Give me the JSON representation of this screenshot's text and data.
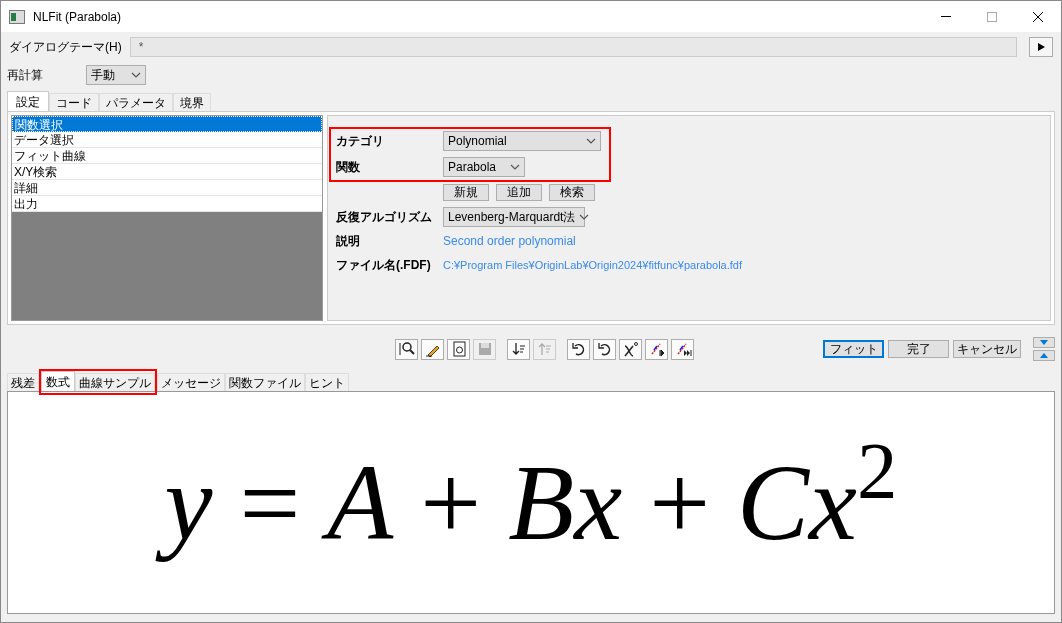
{
  "window": {
    "title": "NLFit (Parabola)"
  },
  "theme": {
    "label": "ダイアログテーマ(H)",
    "value": "*"
  },
  "recalc": {
    "label": "再計算",
    "value": "手動"
  },
  "tabs": [
    {
      "label": "設定",
      "selected": true
    },
    {
      "label": "コード",
      "selected": false
    },
    {
      "label": "パラメータ",
      "selected": false
    },
    {
      "label": "境界",
      "selected": false
    }
  ],
  "nav_list": [
    {
      "label": "関数選択",
      "selected": true
    },
    {
      "label": "データ選択",
      "selected": false
    },
    {
      "label": "フィット曲線",
      "selected": false
    },
    {
      "label": "X/Y検索",
      "selected": false
    },
    {
      "label": "詳細",
      "selected": false
    },
    {
      "label": "出力",
      "selected": false
    }
  ],
  "settings": {
    "category": {
      "label": "カテゴリ",
      "value": "Polynomial"
    },
    "function": {
      "label": "関数",
      "value": "Parabola"
    },
    "function_buttons": [
      "新規",
      "追加",
      "検索"
    ],
    "algorithm": {
      "label": "反復アルゴリズム",
      "value": "Levenberg-Marquardt法"
    },
    "description": {
      "label": "説明",
      "value": "Second order polynomial"
    },
    "file": {
      "label": "ファイル名(.FDF)",
      "value": "C:¥Program Files¥OriginLab¥Origin2024¥fitfunc¥parabola.fdf"
    }
  },
  "toolbar": [
    {
      "kind": "search",
      "disabled": false
    },
    {
      "kind": "edit",
      "disabled": false
    },
    {
      "kind": "doc",
      "disabled": false
    },
    {
      "kind": "save",
      "disabled": true
    },
    {
      "kind": "sortdown",
      "disabled": false
    },
    {
      "kind": "sortup",
      "disabled": true
    },
    {
      "kind": "undo",
      "disabled": false
    },
    {
      "kind": "undo",
      "disabled": false
    },
    {
      "kind": "chi",
      "disabled": false
    },
    {
      "kind": "step",
      "disabled": false
    },
    {
      "kind": "stepend",
      "disabled": false
    }
  ],
  "actions": [
    {
      "label": "フィット",
      "default": true
    },
    {
      "label": "完了",
      "default": false
    },
    {
      "label": "キャンセル",
      "default": false
    }
  ],
  "bottom_tabs": [
    {
      "label": "残差",
      "selected": false
    },
    {
      "label": "数式",
      "selected": true
    },
    {
      "label": "曲線サンプル",
      "selected": false
    },
    {
      "label": "メッセージ",
      "selected": false
    },
    {
      "label": "関数ファイル",
      "selected": false
    },
    {
      "label": "ヒント",
      "selected": false
    }
  ],
  "equation": "*y* = *A* + *Bx* + *Cx*$^{2}$"
}
